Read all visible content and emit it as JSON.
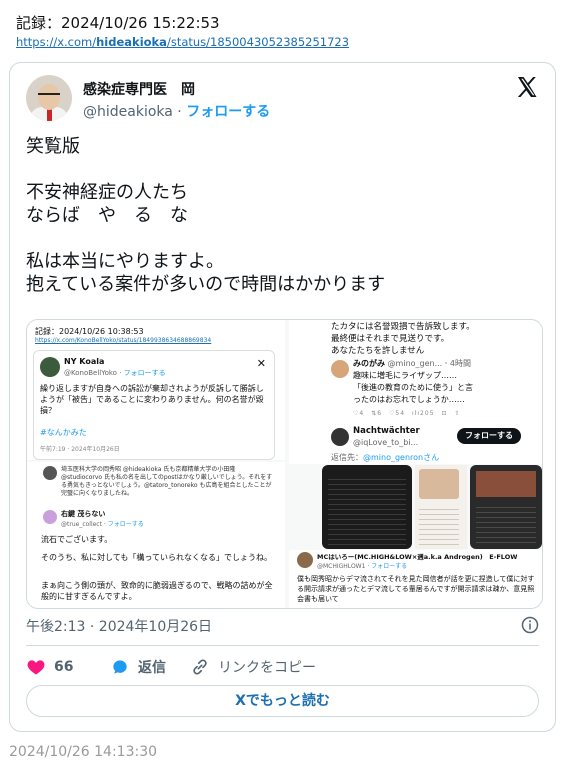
{
  "record": {
    "line": "記録：2024/10/26 15:22:53",
    "url_prefix": "https://x.com/",
    "url_handle": "hideakioka",
    "url_suffix": "/status/1850043052385251723"
  },
  "tweet": {
    "author_name": "感染症専門医　岡",
    "handle": "@hideakioka",
    "separator": " · ",
    "follow_label": "フォローする",
    "text": "笑覧版\n\n不安神経症の人たち\nならば　や　る　な\n\n私は本当にやりますよ。\n抱えている案件が多いので時間はかかります",
    "timestamp": "午後2:13 · 2024年10月26日",
    "likes": "66",
    "reply_label": "返信",
    "copy_link_label": "リンクをコピー",
    "read_more_label": "Xでもっと読む"
  },
  "embedded": {
    "left": {
      "record_line": "記録：2024/10/26 10:38:53",
      "url": "https://x.com/KonoBellYoko/status/1849938634688869834",
      "name": "NY Koala",
      "handle": "@KonoBellYoko",
      "follow": "フォローする",
      "text": "繰り返しますが自身への訴訟が棄却されようが反訴して勝訴しようが「被告」であることに変わりありません。何の名誉が毀損？",
      "tag": "#なんかみた",
      "time": "午前7:19 · 2024年10月26日"
    },
    "left_bottom": {
      "reply_text": "埼玉医科大学の岡秀昭 @hideakioka 氏も京都精華大学の小田隆 @studiocorvo 氏も私の名を出してのpostはかなり厳しいでしょう。それをする勇気もきっとないでしょう。@tatoro_tonoreko も広島を組合としたことが完璧に向くなりましたね。",
      "name": "右鍵 茂らない",
      "handle": "@true_collect",
      "follow": "フォローする",
      "text1": "流石でございます。",
      "text2": "そのうち、私に対しても「構っていられなくなる」でしょうね。",
      "text3": "まぁ向こう側の頭が、致命的に脆弱過ぎるので、戦略の詰めが全般的に甘すぎるんですよ。"
    },
    "right_top": {
      "text_a": "たカタには名誉毀損で告訴致します。",
      "text_b": "最終便はそれまで見送りです。",
      "text_c": "あなたたちを許しません",
      "name1": "みのがみ",
      "handle1": "@mino_gen...",
      "time1": "4時間",
      "text1a": "趣味に増毛にライザップ……",
      "text1b": "「後進の教育のために使う」と言",
      "text1c": "ったのはお忘れでしょうか……",
      "name2": "Nachtwächter",
      "handle2": "@iqLove_to_bi...",
      "follow2": "フォローする",
      "reply_to": "返信先：",
      "reply_handle": "@mino_genronさん"
    },
    "right_bottom": {
      "name": "MCはいろー(MC.HIGH&LOW×週a.k.a Androgen)　E-FLOW",
      "handle": "@MCHIGHLOW1",
      "follow": "フォローする",
      "text": "僕も岡秀昭からデマ流されてそれを見た岡信者が話を更に捏造して僕に対する開示請求が通ったとデマ流してる輩居るんですが開示請求は疎か、意見照会書も届いて"
    }
  },
  "footer": {
    "time": "2024/10/26 14:13:30"
  },
  "colors": {
    "accent": "#1d9bf0",
    "like": "#f91880",
    "muted": "#536471"
  }
}
